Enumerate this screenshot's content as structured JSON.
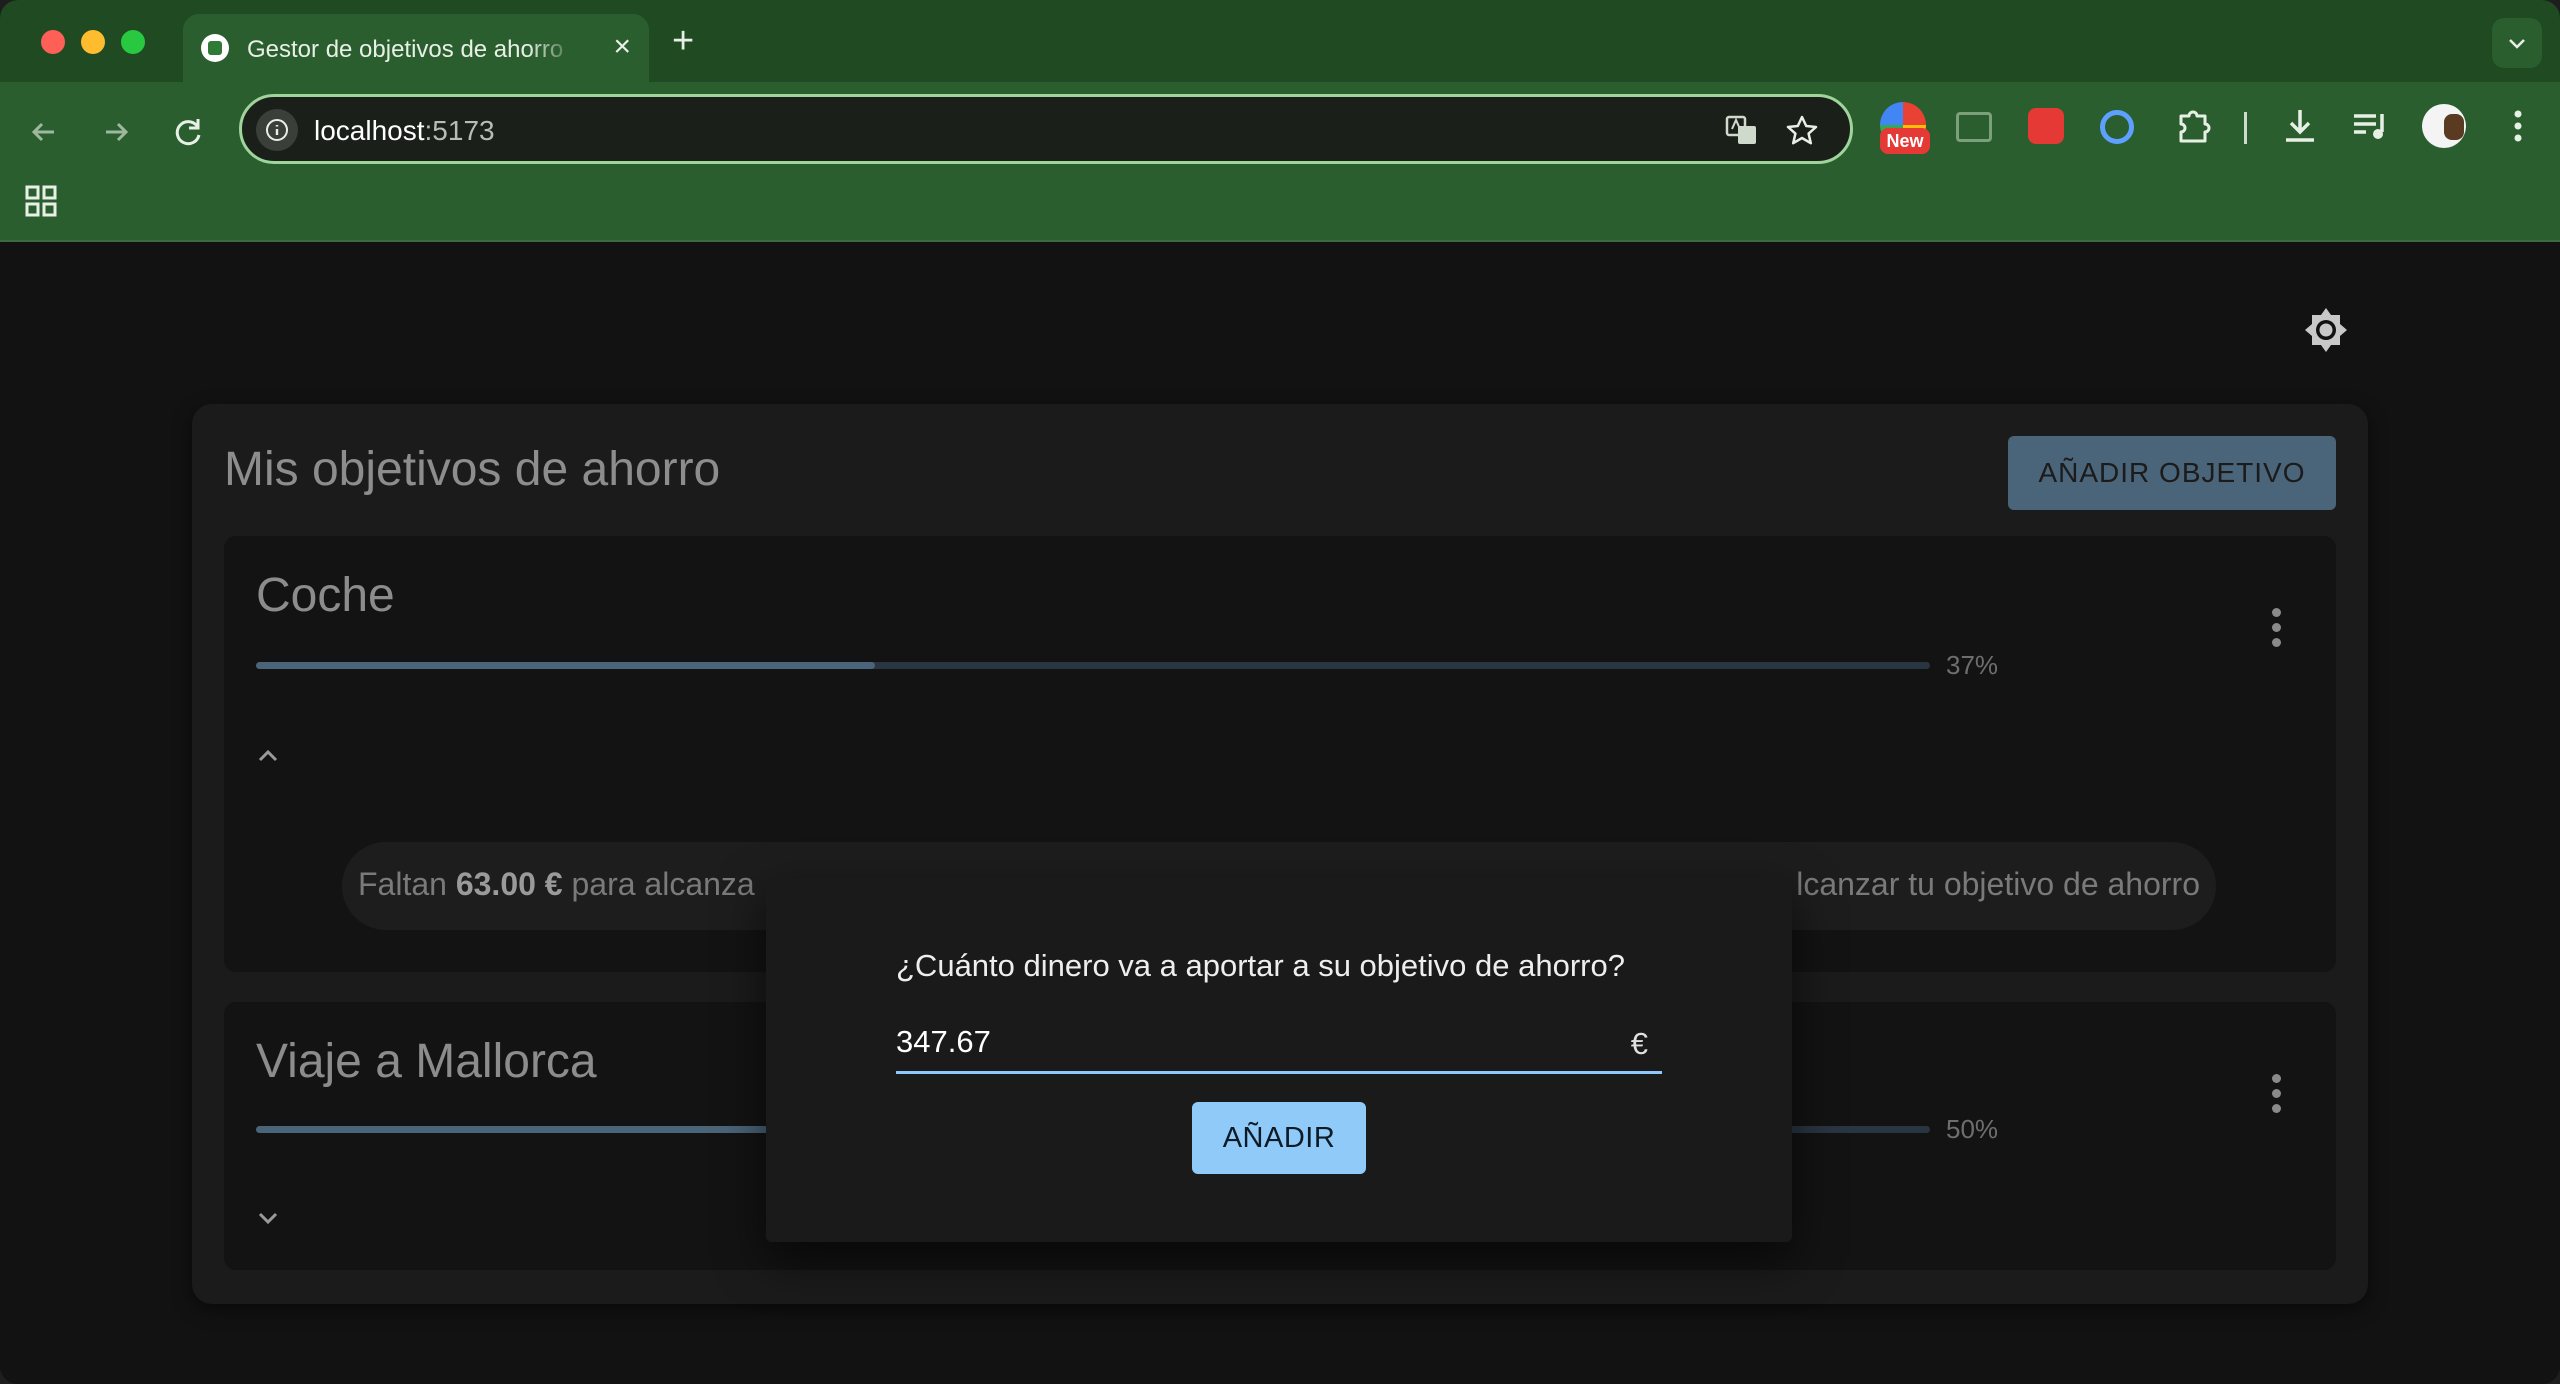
{
  "browser": {
    "tab_title": "Gestor de objetivos de ahorro",
    "url_host": "localhost",
    "url_port": ":5173",
    "new_badge": "New"
  },
  "page": {
    "title": "Mis objetivos de ahorro",
    "add_goal_label": "AÑADIR OBJETIVO"
  },
  "goals": [
    {
      "name": "Coche",
      "progress_percent": 37,
      "percent_label": "37%",
      "expanded": true,
      "info_prefix": "Faltan ",
      "info_amount": "63.00 €",
      "info_suffix_left": " para alcanza",
      "info_suffix_right": "lcanzar tu objetivo de ahorro"
    },
    {
      "name": "Viaje a Mallorca",
      "progress_percent": 50,
      "percent_label": "50%",
      "expanded": false
    }
  ],
  "dialog": {
    "question": "¿Cuánto dinero va a aportar a su objetivo de ahorro?",
    "amount_value": "347.67",
    "currency": "€",
    "submit_label": "AÑADIR"
  },
  "colors": {
    "accent": "#90caf9",
    "chrome": "#2a5e2e",
    "progress_fill": "#4a6479"
  }
}
